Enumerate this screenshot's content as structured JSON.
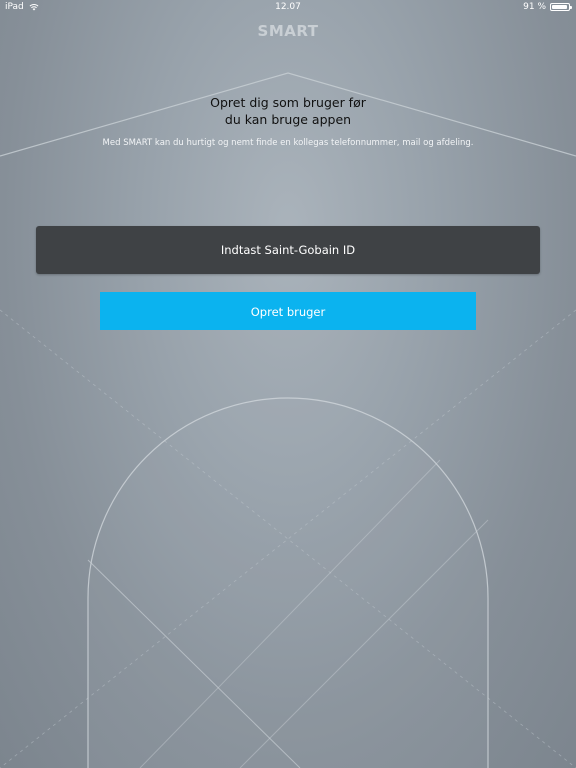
{
  "status_bar": {
    "device": "iPad",
    "time": "12.07",
    "battery": "91 %",
    "battery_level": 0.91
  },
  "header": {
    "title": "SMART"
  },
  "intro": {
    "headline_line1": "Opret dig som bruger før",
    "headline_line2": "du kan bruge appen",
    "description": "Med SMART kan du hurtigt og nemt finde en kollegas telefonnummer, mail og afdeling."
  },
  "form": {
    "id_placeholder": "Indtast Saint-Gobain ID",
    "id_value": "",
    "submit_label": "Opret bruger"
  },
  "colors": {
    "button": "#0bb3ef",
    "input_background": "#3f4245",
    "title": "#c9cfd4"
  }
}
